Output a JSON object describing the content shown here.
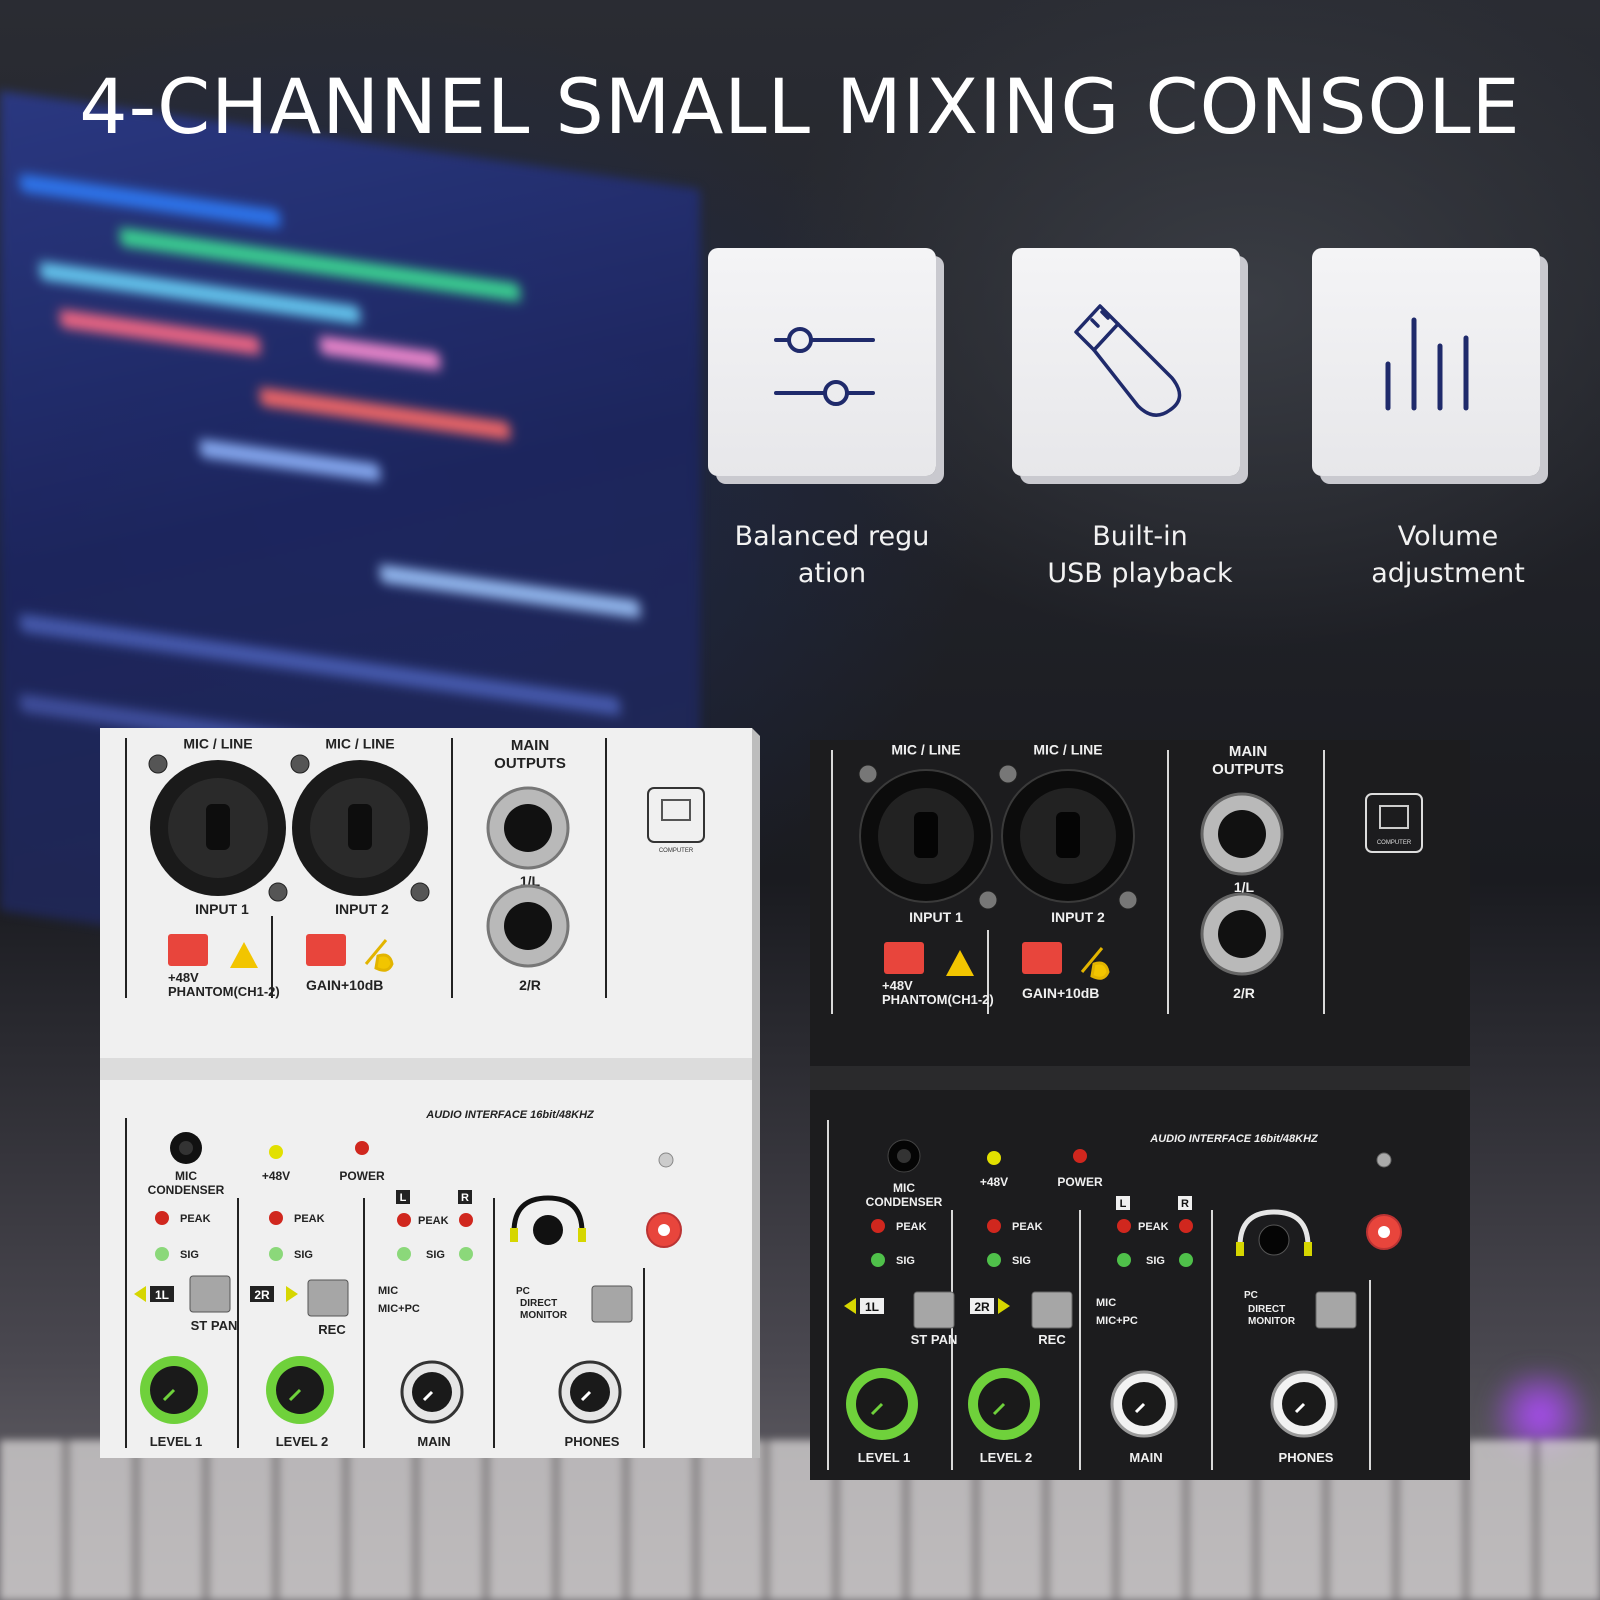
{
  "headline": "4-CHANNEL SMALL MIXING CONSOLE",
  "features": [
    {
      "icon": "slider-adjust-icon",
      "line1": "Balanced regu",
      "line2": "ation"
    },
    {
      "icon": "usb-drive-icon",
      "line1": "Built-in",
      "line2": "USB playback"
    },
    {
      "icon": "volume-bars-icon",
      "line1": "Volume",
      "line2": "adjustment"
    }
  ],
  "mixer_labels": {
    "mic_line": "MIC / LINE",
    "input1": "INPUT 1",
    "input2": "INPUT 2",
    "main_outputs_1": "MAIN",
    "main_outputs_2": "OUTPUTS",
    "out_1l": "1/L",
    "out_2r": "2/R",
    "phantom_1": "+48V",
    "phantom_2": "PHANTOM(CH1-2)",
    "gain": "GAIN+10dB",
    "computer": "COMPUTER",
    "audio_interface": "AUDIO INTERFACE 16bit/48KHZ",
    "mic_condenser_1": "MIC",
    "mic_condenser_2": "CONDENSER",
    "led_48v": "+48V",
    "power": "POWER",
    "peak": "PEAK",
    "sig": "SIG",
    "l": "L",
    "r": "R",
    "badge_1l": "1L",
    "badge_2r": "2R",
    "st_pan": "ST PAN",
    "rec": "REC",
    "mic": "MIC",
    "mic_pc": "MIC+PC",
    "pc": "PC",
    "direct_1": "DIRECT",
    "direct_2": "MONITOR",
    "level1": "LEVEL 1",
    "level2": "LEVEL 2",
    "main": "MAIN",
    "phones": "PHONES"
  },
  "colors": {
    "white_body": "#f1f1f1",
    "black_body": "#1c1c1e",
    "accent_knob": "#6fd13b",
    "button_red": "#e8453c",
    "icon_navy": "#1f2a6b"
  }
}
